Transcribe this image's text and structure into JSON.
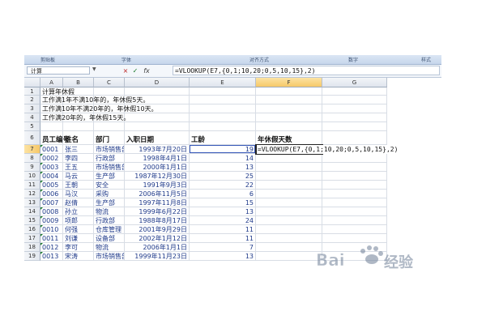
{
  "ribbon": {
    "groups": [
      "剪贴板",
      "字体",
      "对齐方式",
      "数字",
      "样式"
    ]
  },
  "formula_bar": {
    "name_box": "计算",
    "cancel_icon": "×",
    "enter_icon": "✓",
    "fx_label": "fx",
    "formula": "=VLOOKUP(E7,{0,1;10,20;0,5,10,15},2)"
  },
  "columns": [
    "A",
    "B",
    "C",
    "D",
    "E",
    "F",
    "G"
  ],
  "rows": [
    "1",
    "2",
    "3",
    "4",
    "5",
    "6",
    "7",
    "8",
    "9",
    "10",
    "11",
    "12",
    "13",
    "14",
    "15",
    "16",
    "17",
    "18",
    "19"
  ],
  "notes": [
    "计算年休假",
    "工作满1年不满10年的，年休假5天。",
    "工作满10年不满20年的，年休假10天。",
    "工作满20年的，年休假15天。"
  ],
  "table": {
    "headers": [
      "员工编号",
      "姓名",
      "部门",
      "入职日期",
      "工龄",
      "年休假天数"
    ],
    "rows": [
      [
        "0001",
        "张三",
        "市场销售部",
        "1993年7月20日",
        "19"
      ],
      [
        "0002",
        "李四",
        "行政部",
        "1998年4月1日",
        "14"
      ],
      [
        "0003",
        "王五",
        "市场销售部",
        "2000年1月1日",
        "13"
      ],
      [
        "0004",
        "马云",
        "生产部",
        "1987年12月30日",
        "25"
      ],
      [
        "0005",
        "王朝",
        "安全",
        "1991年9月3日",
        "22"
      ],
      [
        "0006",
        "马汉",
        "采购",
        "2006年11月5日",
        "6"
      ],
      [
        "0007",
        "赵倩",
        "生产部",
        "1997年11月8日",
        "15"
      ],
      [
        "0008",
        "孙立",
        "物流",
        "1999年6月22日",
        "13"
      ],
      [
        "0009",
        "项郎",
        "行政部",
        "1988年8月17日",
        "24"
      ],
      [
        "0010",
        "何强",
        "仓库管理",
        "2001年9月29日",
        "11"
      ],
      [
        "0011",
        "刘谦",
        "设备部",
        "2002年1月12日",
        "11"
      ],
      [
        "0012",
        "李可",
        "物流",
        "2006年1月1日",
        "7"
      ],
      [
        "0013",
        "宋涛",
        "市场销售部",
        "1999年11月23日",
        "13"
      ]
    ],
    "editing_formula": "=VLOOKUP(E7,{0,1;10,20;0,5,10,15},2)"
  },
  "watermark": {
    "text": "Bai 经验"
  },
  "colors": {
    "accent": "#f6c868",
    "header": "#dfe5ee",
    "error_flag": "#1e7a2e"
  }
}
